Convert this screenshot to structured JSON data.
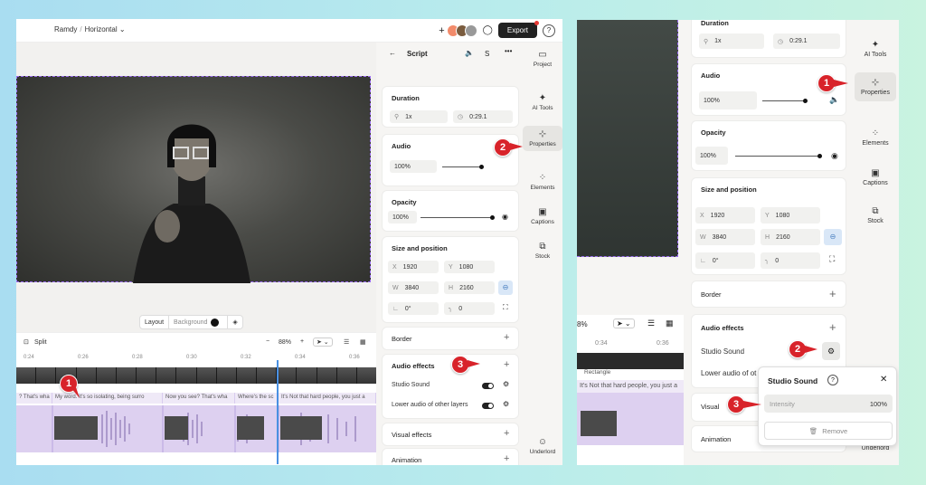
{
  "left": {
    "breadcrumb": {
      "project": "Ramdy",
      "format": "Horizontal ⌄"
    },
    "export_label": "Export",
    "layout_bar": {
      "layout": "Layout",
      "background": "Background"
    },
    "timeline": {
      "split": "Split",
      "zoom": "88%",
      "ruler": [
        "0:24",
        "0:26",
        "0:28",
        "0:30",
        "0:32",
        "0:34",
        "0:36"
      ],
      "captions": [
        "? That's wha",
        "My word. It's so isolating, being surro",
        "Now you see? That's wha",
        "Where's the sc",
        "It's Not that hard people, you just a"
      ]
    },
    "props": {
      "title": "Script",
      "s_label": "S",
      "duration": {
        "title": "Duration",
        "speed": "1x",
        "time": "0:29.1"
      },
      "audio": {
        "title": "Audio",
        "volume": "100%"
      },
      "opacity": {
        "title": "Opacity",
        "value": "100%"
      },
      "size": {
        "title": "Size and position",
        "x": "1920",
        "y": "1080",
        "w": "3840",
        "h": "2160",
        "rot": "0°",
        "radius": "0",
        "xl": "X",
        "yl": "Y",
        "wl": "W",
        "hl": "H"
      },
      "border": "Border",
      "audio_effects": {
        "title": "Audio effects",
        "studio_sound": "Studio Sound",
        "lower_audio": "Lower audio of other layers"
      },
      "visual_effects": "Visual effects",
      "animation": "Animation"
    },
    "sidebar": [
      "Project",
      "AI Tools",
      "Properties",
      "Elements",
      "Captions",
      "Stock",
      "Underlord"
    ],
    "badges": [
      "1",
      "2",
      "3"
    ]
  },
  "right": {
    "duration": {
      "title": "Duration",
      "speed": "1x",
      "time": "0:29.1"
    },
    "audio": {
      "title": "Audio",
      "volume": "100%"
    },
    "opacity": {
      "title": "Opacity",
      "value": "100%"
    },
    "size": {
      "title": "Size and position",
      "x": "1920",
      "y": "1080",
      "w": "3840",
      "h": "2160",
      "rot": "0°",
      "radius": "0"
    },
    "border": "Border",
    "audio_effects": {
      "title": "Audio effects",
      "studio_sound": "Studio Sound",
      "lower_audio": "Lower audio of ot"
    },
    "visual": "Visual",
    "animation": "Animation",
    "timeline": {
      "zoom": "8%",
      "ruler": [
        "0:34",
        "0:36"
      ],
      "caption": "It's Not that hard people, you just a",
      "rect": "Rectangle"
    },
    "popup": {
      "title": "Studio Sound",
      "intensity_label": "Intensity",
      "intensity_value": "100%",
      "remove": "Remove"
    },
    "sidebar": [
      "AI Tools",
      "Properties",
      "Elements",
      "Captions",
      "Stock",
      "Underlord"
    ],
    "badges": [
      "1",
      "2",
      "3"
    ]
  },
  "colors": {
    "badge": "#d8232a",
    "accent": "#9a6cf0",
    "audio_track": "#ddd0f0"
  }
}
